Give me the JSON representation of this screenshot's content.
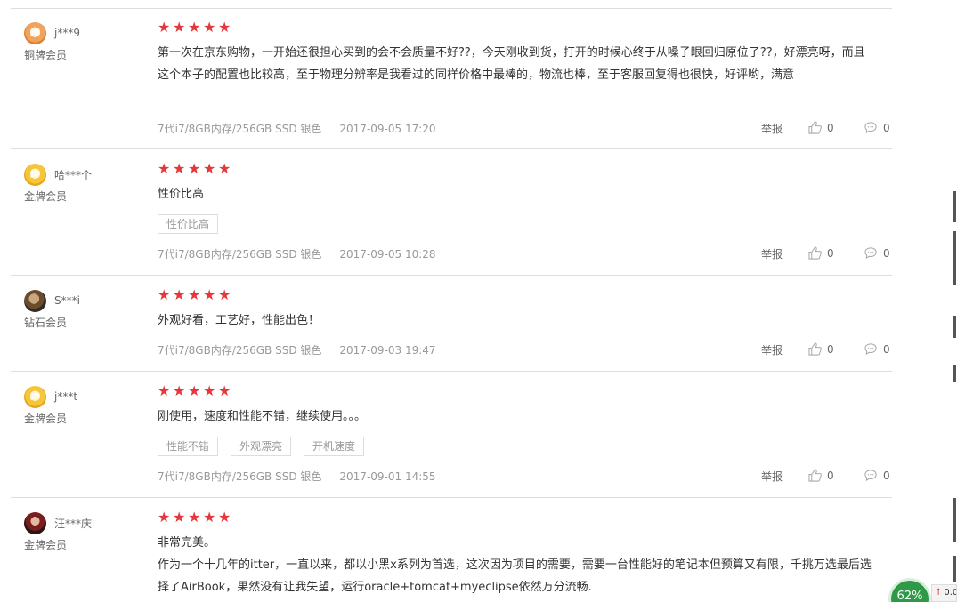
{
  "reviews": [
    {
      "nickname": "j***9",
      "level": "铜牌会员",
      "avatar": "copper-badge",
      "stars": 5,
      "content": "第一次在京东购物，一开始还很担心买到的会不会质量不好??，今天刚收到货，打开的时候心终于从嗓子眼回归原位了??，好漂亮呀，而且这个本子的配置也比较高，至于物理分辨率是我看过的同样价格中最棒的，物流也棒，至于客服回复得也很快，好评哟，满意",
      "tags": [],
      "spec": "7代i7/8GB内存/256GB SSD 银色",
      "date": "2017-09-05 17:20",
      "report": "举报",
      "likes": "0",
      "replies": "0"
    },
    {
      "nickname": "哈***个",
      "level": "金牌会员",
      "avatar": "gold-badge",
      "stars": 5,
      "content": "性价比高",
      "tags": [
        "性价比高"
      ],
      "spec": "7代i7/8GB内存/256GB SSD 银色",
      "date": "2017-09-05 10:28",
      "report": "举报",
      "likes": "0",
      "replies": "0"
    },
    {
      "nickname": "S***i",
      "level": "钻石会员",
      "avatar": "photo",
      "stars": 5,
      "content": "外观好看，工艺好，性能出色！",
      "tags": [],
      "spec": "7代i7/8GB内存/256GB SSD 银色",
      "date": "2017-09-03 19:47",
      "report": "举报",
      "likes": "0",
      "replies": "0"
    },
    {
      "nickname": "j***t",
      "level": "金牌会员",
      "avatar": "gold-badge",
      "stars": 5,
      "content": "刚使用，速度和性能不错，继续使用。。。",
      "tags": [
        "性能不错",
        "外观漂亮",
        "开机速度"
      ],
      "spec": "7代i7/8GB内存/256GB SSD 银色",
      "date": "2017-09-01 14:55",
      "report": "举报",
      "likes": "0",
      "replies": "0"
    },
    {
      "nickname": "汪***庆",
      "level": "金牌会员",
      "avatar": "photo",
      "stars": 5,
      "content": "非常完美。",
      "content2": "作为一个十几年的itter，一直以来，都以小黑x系列为首选，这次因为项目的需要，需要一台性能好的笔记本但预算又有限，千挑万选最后选择了AirBook，果然没有让我失望，运行oracle+tomcat+myeclipse依然万分流畅."
    }
  ],
  "floating": {
    "percent": "62%",
    "speed": "0.0"
  },
  "colors": {
    "star": "#e4393c",
    "border": "#dddddd",
    "muted": "#999999"
  }
}
